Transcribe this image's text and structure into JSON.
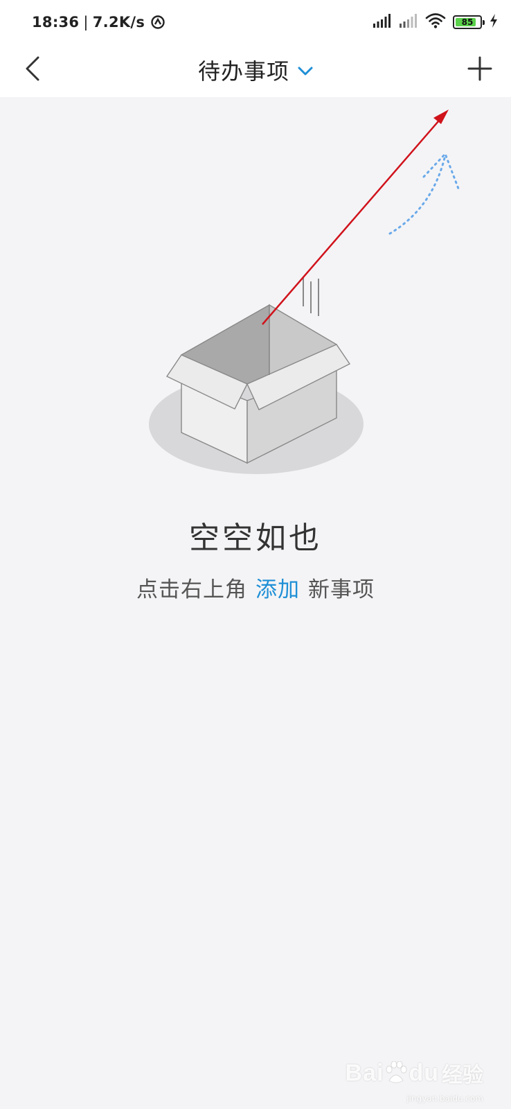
{
  "status_bar": {
    "time": "18:36",
    "separator": "|",
    "net_speed": "7.2K/s",
    "battery_level": "85",
    "battery_fraction": 0.85
  },
  "header": {
    "title": "待办事项"
  },
  "empty_state": {
    "title": "空空如也",
    "hint_before": "点击右上角",
    "hint_link": "添加",
    "hint_after": "新事项"
  },
  "watermark": {
    "brand_left": "Bai",
    "brand_right": "du",
    "brand_cn": "经验",
    "site": "jingyan.baidu.com"
  },
  "icons": {
    "back": "chevron-left-icon",
    "add": "plus-icon",
    "title_dropdown": "chevron-down-icon",
    "signal": "signal-icon",
    "wifi": "wifi-icon",
    "charging": "lightning-icon"
  },
  "colors": {
    "accent": "#1e8fd6",
    "annotation_arrow": "#d0121b",
    "battery_fill": "#5bd14b",
    "background": "#f4f4f6"
  }
}
